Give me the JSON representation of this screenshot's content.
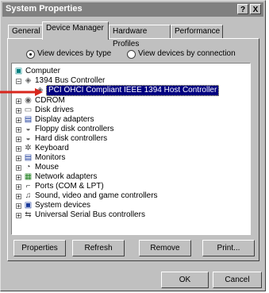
{
  "window": {
    "title": "System Properties"
  },
  "titlebar_buttons": {
    "help": "?",
    "close": "X"
  },
  "tabs": [
    {
      "label": "General",
      "active": false
    },
    {
      "label": "Device Manager",
      "active": true
    },
    {
      "label": "Hardware Profiles",
      "active": false
    },
    {
      "label": "Performance",
      "active": false
    }
  ],
  "view_options": {
    "by_type": "View devices by type",
    "by_connection": "View devices by connection",
    "selected": "by_type"
  },
  "tree": {
    "root": "Computer",
    "items": [
      {
        "label": "1394 Bus Controller",
        "icon": "bus-icon",
        "expanded": true
      },
      {
        "label": "PCI OHCI Compliant IEEE 1394 Host Controller",
        "icon": "controller-icon",
        "child": true,
        "selected": true
      },
      {
        "label": "CDROM",
        "icon": "cdrom-icon"
      },
      {
        "label": "Disk drives",
        "icon": "disk-icon"
      },
      {
        "label": "Display adapters",
        "icon": "display-icon"
      },
      {
        "label": "Floppy disk controllers",
        "icon": "floppy-icon"
      },
      {
        "label": "Hard disk controllers",
        "icon": "harddisk-icon"
      },
      {
        "label": "Keyboard",
        "icon": "keyboard-icon"
      },
      {
        "label": "Monitors",
        "icon": "monitor-icon"
      },
      {
        "label": "Mouse",
        "icon": "mouse-icon"
      },
      {
        "label": "Network adapters",
        "icon": "network-icon"
      },
      {
        "label": "Ports (COM & LPT)",
        "icon": "port-icon"
      },
      {
        "label": "Sound, video and game controllers",
        "icon": "sound-icon"
      },
      {
        "label": "System devices",
        "icon": "system-icon"
      },
      {
        "label": "Universal Serial Bus controllers",
        "icon": "usb-icon"
      }
    ]
  },
  "buttons": {
    "properties": "Properties",
    "refresh": "Refresh",
    "remove": "Remove",
    "print": "Print...",
    "ok": "OK",
    "cancel": "Cancel"
  },
  "colors": {
    "selection": "#000080",
    "annotation_arrow": "#d8261c"
  }
}
